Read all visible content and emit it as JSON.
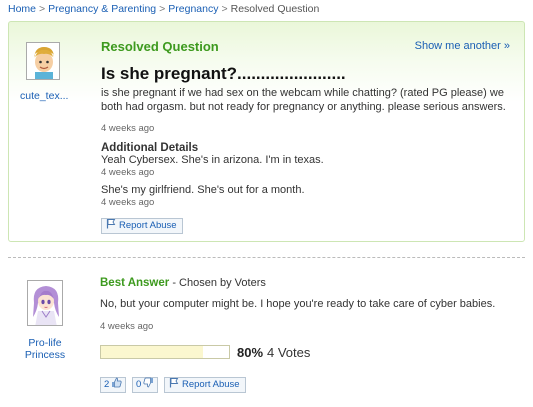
{
  "breadcrumb": {
    "items": [
      "Home",
      "Pregnancy & Parenting",
      "Pregnancy"
    ],
    "current": "Resolved Question",
    "separator": ">"
  },
  "question": {
    "status": "Resolved Question",
    "show_another": "Show me another »",
    "title": "Is she pregnant?.......................",
    "body": "is she pregnant if we had sex on the webcam while chatting? (rated PG please) we both had orgasm. but not ready for pregnancy or anything. please serious answers.",
    "time": "4 weeks ago",
    "asker": "cute_tex...",
    "additional_details_heading": "Additional Details",
    "details": [
      {
        "text": "Yeah Cybersex. She's in arizona. I'm in texas.",
        "time": "4 weeks ago"
      },
      {
        "text": "She's my girlfriend. She's out for a month.",
        "time": "4 weeks ago"
      }
    ],
    "report_abuse": "Report Abuse"
  },
  "answer": {
    "label": "Best Answer",
    "chosen_by": "- Chosen by Voters",
    "body": "No, but your computer might be. I hope you're ready to take care of cyber babies.",
    "time": "4 weeks ago",
    "answerer": "Pro-life Princess",
    "vote_percent": "80%",
    "vote_fraction": 0.8,
    "votes": "4 Votes",
    "thumbs_up": "2",
    "thumbs_down": "0",
    "report_abuse": "Report Abuse"
  },
  "colors": {
    "link": "#1a5fb4",
    "status_green": "#3d9a1e",
    "panel_bg": "#eaf7d9",
    "vote_fill": "#fbf7cf"
  },
  "icons": {
    "flag": "flag-icon",
    "thumbs_up": "thumbs-up-icon",
    "thumbs_down": "thumbs-down-icon"
  }
}
